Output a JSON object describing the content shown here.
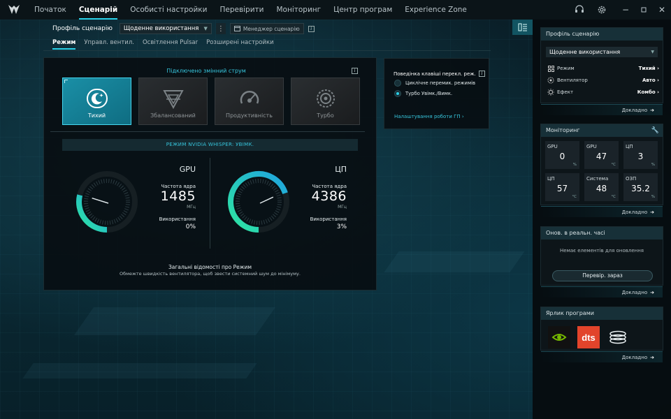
{
  "nav": {
    "items": [
      "Початок",
      "Сценарій",
      "Особисті настройки",
      "Перевірити",
      "Моніторинг",
      "Центр програм",
      "Experience Zone"
    ],
    "active_index": 1
  },
  "profile": {
    "label": "Профіль сценарію",
    "value": "Щоденне використання",
    "manager_label": "Менеджер сценарію"
  },
  "subtabs": [
    "Режим",
    "Управл. вентил.",
    "Освітлення Pulsar",
    "Розширені настройки"
  ],
  "mode": {
    "heading": "Підключено змінний струм",
    "cards": [
      {
        "label": "Тихий",
        "icon": "moon-mode-icon",
        "active": true
      },
      {
        "label": "Збалансований",
        "icon": "balanced-mode-icon",
        "active": false
      },
      {
        "label": "Продуктивність",
        "icon": "performance-mode-icon",
        "active": false
      },
      {
        "label": "Турбо",
        "icon": "turbo-mode-icon",
        "active": false
      }
    ],
    "whisper": "РЕЖИМ NVIDIA WHISPER: УВІМК."
  },
  "gpu": {
    "title": "GPU",
    "freq_label": "Частота ядра",
    "freq_value": "1485",
    "freq_unit": "МГц",
    "usage_label": "Використання",
    "usage_value": "0%",
    "usage_fraction": 0.33
  },
  "cpu": {
    "title": "ЦП",
    "freq_label": "Частота ядра",
    "freq_value": "4386",
    "freq_unit": "МГц",
    "usage_label": "Використання",
    "usage_value": "3%",
    "usage_fraction": 0.8
  },
  "mode_info": {
    "title": "Загальні відомості про Режим",
    "description": "Обмежте швидкість вентилятора, щоб звести системний шум до мінімуму."
  },
  "key_behavior": {
    "title": "Поведінка клавіші перекл. реж.",
    "options": [
      "Циклічне перемик. режимів",
      "Турбо Увімк./Вимк."
    ],
    "selected_index": 1,
    "gpu_link": "Налаштування роботи ГП ›"
  },
  "sidebar": {
    "profile_card": {
      "title": "Профіль сценарію",
      "dropdown": "Щоденне використання",
      "rows": [
        {
          "label": "Режим",
          "value": "Тихий ›",
          "icon": "mode-grid-icon"
        },
        {
          "label": "Вентилятор",
          "value": "Авто ›",
          "icon": "fan-icon"
        },
        {
          "label": "Ефект",
          "value": "Комбо ›",
          "icon": "effect-sun-icon"
        }
      ],
      "more": "Докладно"
    },
    "monitor_card": {
      "title": "Моніторинг",
      "cells": [
        {
          "label": "GPU",
          "value": "0",
          "unit": "%"
        },
        {
          "label": "GPU",
          "value": "47",
          "unit": "°C"
        },
        {
          "label": "ЦП",
          "value": "3",
          "unit": "%"
        },
        {
          "label": "ЦП",
          "value": "57",
          "unit": "°C"
        },
        {
          "label": "Система",
          "value": "48",
          "unit": "°C"
        },
        {
          "label": "ОЗП",
          "value": "35.2",
          "unit": "%"
        }
      ],
      "more": "Докладно"
    },
    "update_card": {
      "title": "Онов. в реальн. часі",
      "empty": "Немає елементів для оновлення",
      "button": "Перевір. зараз",
      "more": "Докладно"
    },
    "shortcut_card": {
      "title": "Ярлик програми",
      "apps": [
        "nvidia-app-icon",
        "dts-app-icon",
        "disk-app-icon"
      ],
      "dts_text": "dts",
      "more": "Докладно"
    }
  },
  "colors": {
    "accent": "#2ad1e8",
    "gauge_blue": "#1fa3e0",
    "gauge_green": "#2ee6a0",
    "dts_red": "#e2442b",
    "nvidia_green": "#76b900"
  }
}
